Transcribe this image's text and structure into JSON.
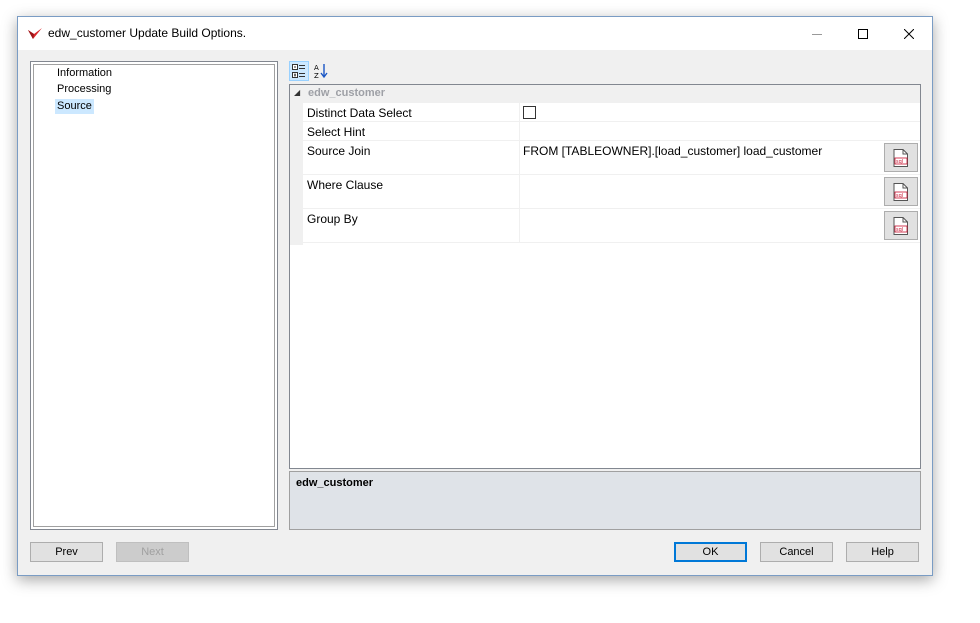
{
  "window": {
    "title": "edw_customer Update Build Options."
  },
  "tree": {
    "items": [
      {
        "label": "Information",
        "selected": false
      },
      {
        "label": "Processing",
        "selected": false
      },
      {
        "label": "Source",
        "selected": true
      }
    ]
  },
  "toolbar": {
    "categorized_icon": "categorized-view-icon",
    "alphabetical_icon": "sort-az-icon"
  },
  "grid": {
    "category": "edw_customer",
    "properties": [
      {
        "name": "Distinct Data Select",
        "value": "",
        "checked": false
      },
      {
        "name": "Select Hint",
        "value": ""
      },
      {
        "name": "Source Join",
        "value": "FROM [TABLEOWNER].[load_customer] load_customer"
      },
      {
        "name": "Where Clause",
        "value": ""
      },
      {
        "name": "Group By",
        "value": ""
      }
    ]
  },
  "description": {
    "title": "edw_customer"
  },
  "buttons": {
    "prev": "Prev",
    "next": "Next",
    "ok": "OK",
    "cancel": "Cancel",
    "help": "Help"
  },
  "colors": {
    "accent": "#0078d7",
    "selection": "#cce8ff",
    "dialog_bg": "#f0f0f0",
    "description_bg": "#dfe3e8"
  }
}
